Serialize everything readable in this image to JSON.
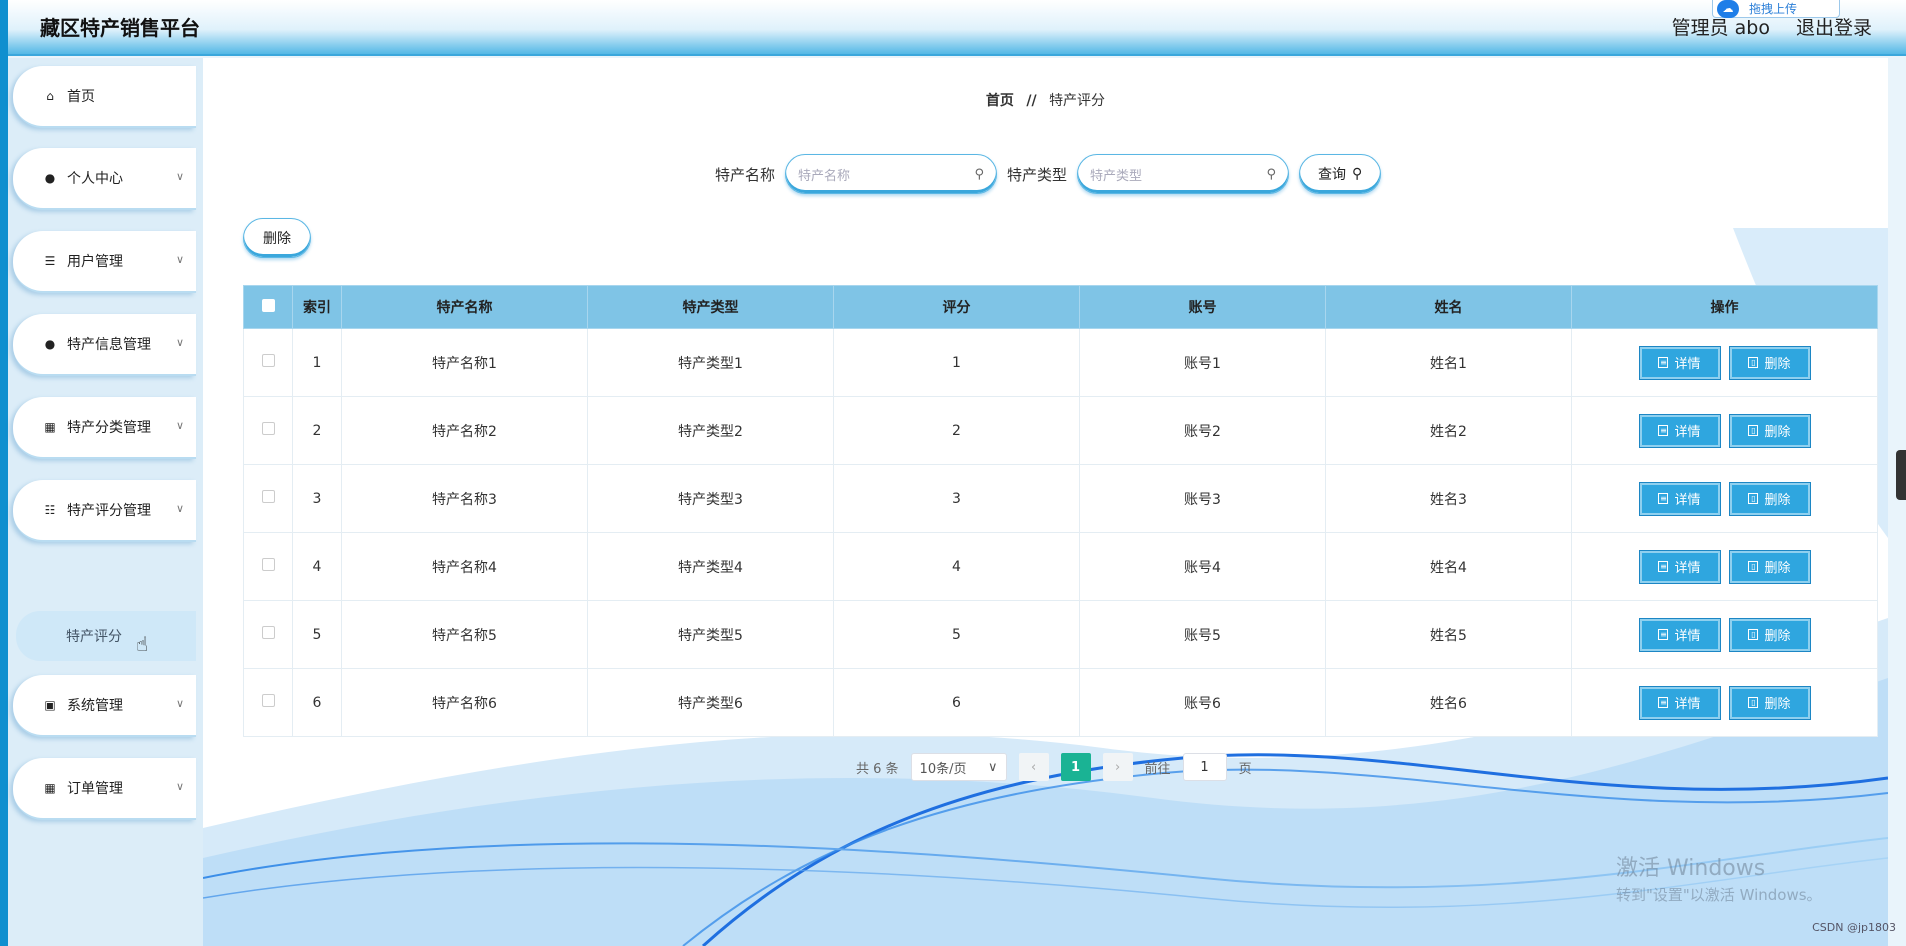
{
  "header": {
    "app_title": "藏区特产销售平台",
    "user_label": "管理员 abo",
    "logout_label": "退出登录",
    "upload_label": "拖拽上传"
  },
  "sidebar": {
    "items": [
      {
        "label": "首页",
        "icon": "home-icon"
      },
      {
        "label": "个人中心",
        "icon": "user-icon"
      },
      {
        "label": "用户管理",
        "icon": "list-icon"
      },
      {
        "label": "特产信息管理",
        "icon": "user-icon"
      },
      {
        "label": "特产分类管理",
        "icon": "grid-icon"
      },
      {
        "label": "特产评分管理",
        "icon": "sliders-icon"
      },
      {
        "label": "系统管理",
        "icon": "clipboard-icon"
      },
      {
        "label": "订单管理",
        "icon": "grid-icon"
      }
    ],
    "active_submenu": "特产评分"
  },
  "breadcrumb": {
    "home": "首页",
    "separator": "//",
    "current": "特产评分"
  },
  "search": {
    "name_label": "特产名称",
    "name_placeholder": "特产名称",
    "type_label": "特产类型",
    "type_placeholder": "特产类型",
    "query_label": "查询"
  },
  "toolbar": {
    "delete_label": "删除"
  },
  "table": {
    "headers": [
      "",
      "索引",
      "特产名称",
      "特产类型",
      "评分",
      "账号",
      "姓名",
      "操作"
    ],
    "rows": [
      {
        "index": "1",
        "name": "特产名称1",
        "type": "特产类型1",
        "score": "1",
        "account": "账号1",
        "person": "姓名1"
      },
      {
        "index": "2",
        "name": "特产名称2",
        "type": "特产类型2",
        "score": "2",
        "account": "账号2",
        "person": "姓名2"
      },
      {
        "index": "3",
        "name": "特产名称3",
        "type": "特产类型3",
        "score": "3",
        "account": "账号3",
        "person": "姓名3"
      },
      {
        "index": "4",
        "name": "特产名称4",
        "type": "特产类型4",
        "score": "4",
        "account": "账号4",
        "person": "姓名4"
      },
      {
        "index": "5",
        "name": "特产名称5",
        "type": "特产类型5",
        "score": "5",
        "account": "账号5",
        "person": "姓名5"
      },
      {
        "index": "6",
        "name": "特产名称6",
        "type": "特产类型6",
        "score": "6",
        "account": "账号6",
        "person": "姓名6"
      }
    ],
    "detail_label": "详情",
    "delete_label": "删除"
  },
  "pagination": {
    "total": "共 6 条",
    "page_size": "10条/页",
    "current_page": "1",
    "goto_prefix": "前往",
    "goto_value": "1",
    "goto_suffix": "页"
  },
  "overlay": {
    "activate_title": "激活 Windows",
    "activate_sub": "转到\"设置\"以激活 Windows。",
    "csdn": "CSDN @jp1803"
  },
  "colors": {
    "header_blue": "#54b8e6",
    "table_header": "#7fc4e6",
    "action_button": "#2fa6df",
    "page_active": "#1ab394"
  }
}
